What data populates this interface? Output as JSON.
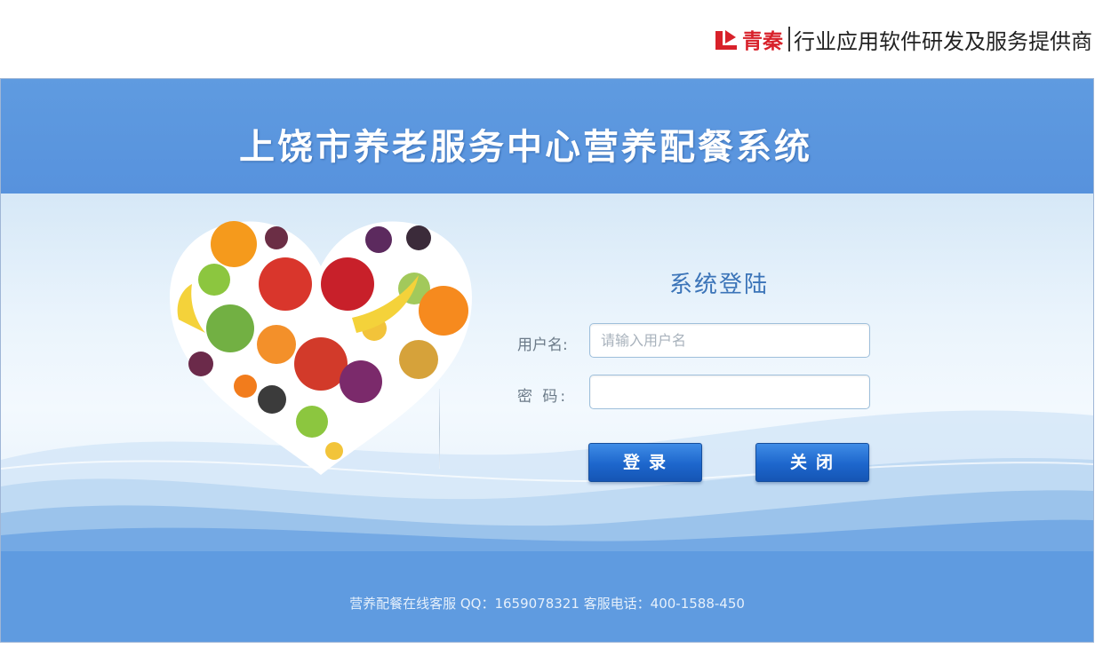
{
  "brand": {
    "logo_icon": "qingqin-logo-icon",
    "name": "青秦",
    "tagline": "行业应用软件研发及服务提供商",
    "color": "#d8212a"
  },
  "header": {
    "title": "上饶市养老服务中心营养配餐系统"
  },
  "login": {
    "title": "系统登陆",
    "username_label": "用户名:",
    "username_placeholder": "请输入用户名",
    "username_value": "",
    "password_label": "密 码:",
    "password_value": "",
    "login_button": "登录",
    "close_button": "关闭"
  },
  "footer": {
    "text": "营养配餐在线客服 QQ：1659078321  客服电话：400-1588-450"
  },
  "colors": {
    "band_blue": "#5f9be0",
    "button_blue": "#1d66cc",
    "login_title": "#3b74b8"
  }
}
